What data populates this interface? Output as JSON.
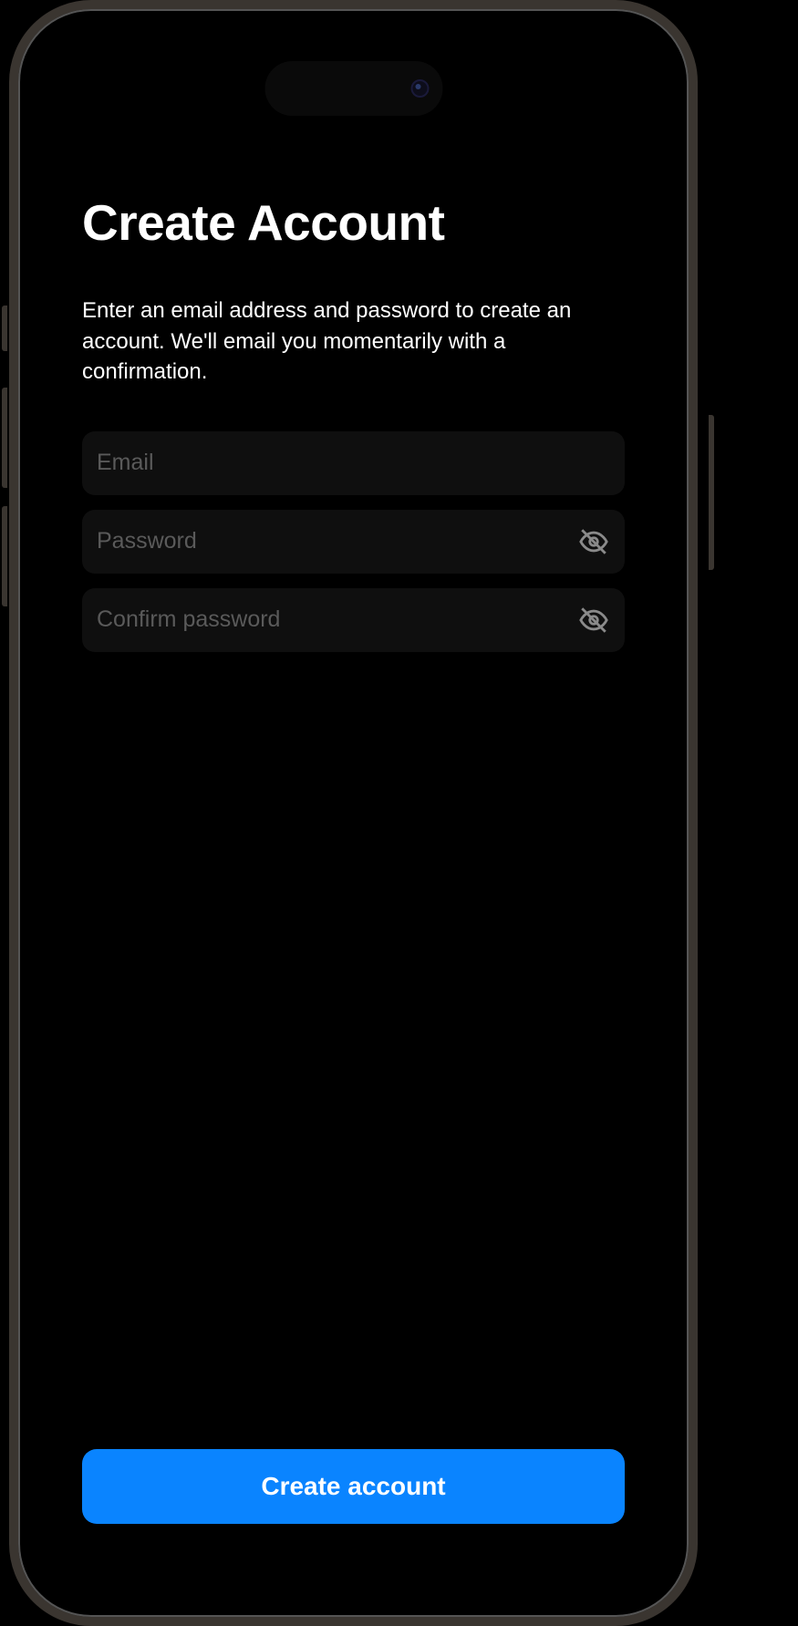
{
  "header": {
    "title": "Create Account",
    "subtitle": "Enter an email address and password to create an account. We'll email you momentarily with a confirmation."
  },
  "form": {
    "email": {
      "placeholder": "Email",
      "value": ""
    },
    "password": {
      "placeholder": "Password",
      "value": ""
    },
    "confirm_password": {
      "placeholder": "Confirm password",
      "value": ""
    }
  },
  "actions": {
    "submit_label": "Create account"
  },
  "colors": {
    "primary": "#0a84ff",
    "background": "#000000",
    "input_background": "#0f0f0f",
    "placeholder": "#5a5a5a",
    "text": "#ffffff"
  }
}
